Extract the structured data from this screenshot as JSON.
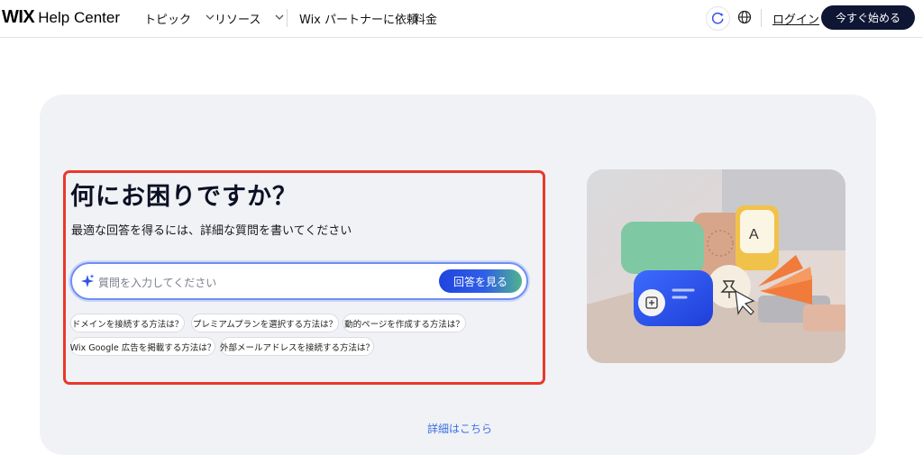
{
  "header": {
    "logo_wix": "WIX",
    "logo_text": "Help Center",
    "nav": [
      {
        "label": "トピック"
      },
      {
        "label": "リソース"
      }
    ],
    "partner_link": "Wix パートナーに依頼",
    "pricing_link": "料金",
    "login": "ログイン",
    "cta": "今すぐ始める"
  },
  "hero": {
    "title": "何にお困りですか？",
    "subtitle": "最適な回答を得るには、詳細な質問を書いてください",
    "search_placeholder": "質問を入力してください",
    "answer_button": "回答を見る",
    "suggestions": [
      "ドメインを接続する方法は？",
      "プレミアムプランを選択する方法は？",
      "動的ページを作成する方法は？",
      "Wix Google 広告を掲載する方法は？",
      "外部メールアドレスを接続する方法は？"
    ],
    "more_link": "詳細はこちら"
  },
  "colors": {
    "accent": "#1f44e0",
    "highlight": "#e8392b",
    "cta_bg": "#0e1634"
  }
}
